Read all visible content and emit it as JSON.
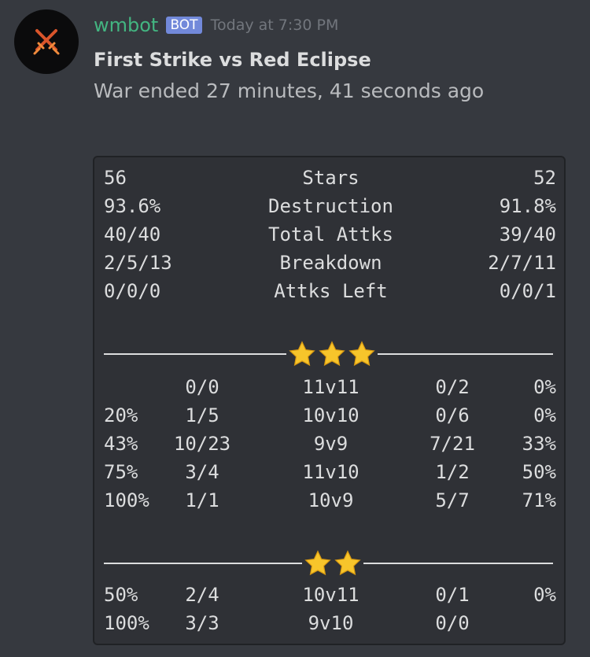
{
  "message": {
    "username": "wmbot",
    "badge": "BOT",
    "timestamp": "Today at 7:30 PM",
    "title": "First Strike vs Red Eclipse",
    "subtitle": "War ended 27 minutes, 41 seconds ago"
  },
  "summary": [
    {
      "left": "56",
      "label": "Stars",
      "right": "52"
    },
    {
      "left": "93.6%",
      "label": "Destruction",
      "right": "91.8%"
    },
    {
      "left": "40/40",
      "label": "Total Attks",
      "right": "39/40"
    },
    {
      "left": "2/5/13",
      "label": "Breakdown",
      "right": "2/7/11"
    },
    {
      "left": "0/0/0",
      "label": "Attks Left",
      "right": "0/0/1"
    }
  ],
  "three_star": {
    "star_count": 3,
    "rows": [
      {
        "pct_left": "",
        "ratio_left": "0/0",
        "matchup": "11v11",
        "ratio_right": "0/2",
        "pct_right": "0%"
      },
      {
        "pct_left": "20%",
        "ratio_left": "1/5",
        "matchup": "10v10",
        "ratio_right": "0/6",
        "pct_right": "0%"
      },
      {
        "pct_left": "43%",
        "ratio_left": "10/23",
        "matchup": "9v9",
        "ratio_right": "7/21",
        "pct_right": "33%"
      },
      {
        "pct_left": "75%",
        "ratio_left": "3/4",
        "matchup": "11v10",
        "ratio_right": "1/2",
        "pct_right": "50%"
      },
      {
        "pct_left": "100%",
        "ratio_left": "1/1",
        "matchup": "10v9",
        "ratio_right": "5/7",
        "pct_right": "71%"
      }
    ]
  },
  "two_star": {
    "star_count": 2,
    "rows": [
      {
        "pct_left": "50%",
        "ratio_left": "2/4",
        "matchup": "10v11",
        "ratio_right": "0/1",
        "pct_right": "0%"
      },
      {
        "pct_left": "100%",
        "ratio_left": "3/3",
        "matchup": "9v10",
        "ratio_right": "0/0",
        "pct_right": ""
      }
    ]
  },
  "colors": {
    "background": "#36393f",
    "codeblock": "#2f3136",
    "username": "#43b581",
    "badge": "#7289da",
    "star": "#f7c52b"
  },
  "icons": {
    "avatar": "crossed-swords-icon",
    "star": "star-icon"
  }
}
